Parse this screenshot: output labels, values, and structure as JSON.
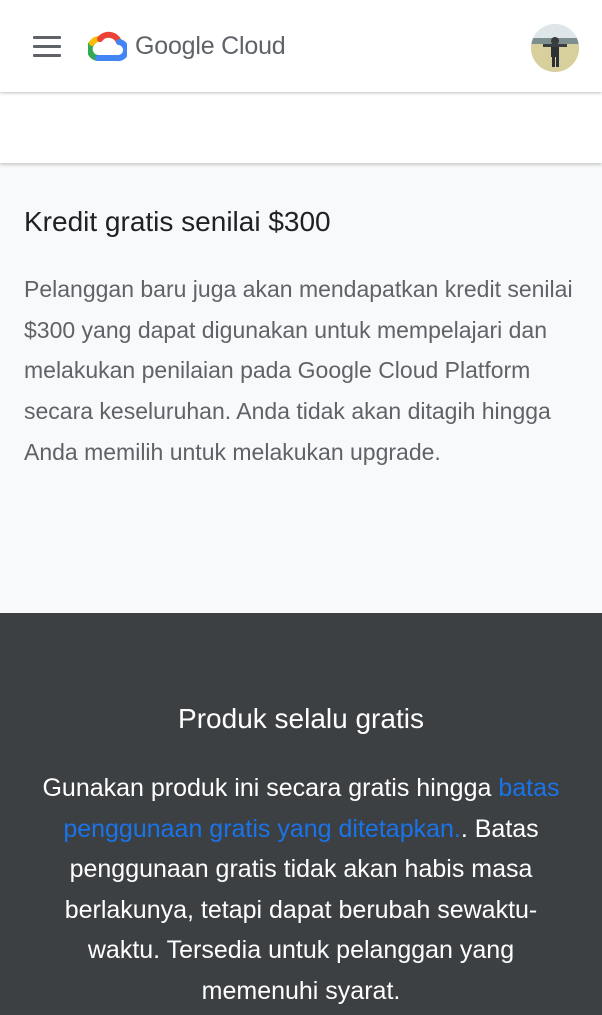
{
  "header": {
    "brand": "Google Cloud",
    "menu_icon": "hamburger-menu-icon",
    "logo_icon": "google-cloud-logo-icon",
    "avatar_icon": "user-avatar",
    "colors": {
      "blue": "#4285f4",
      "red": "#ea4335",
      "yellow": "#fbbc04",
      "green": "#34a853"
    }
  },
  "credit": {
    "title": "Kredit gratis senilai $300",
    "description": "Pelanggan baru juga akan mendapatkan kredit senilai $300 yang dapat digunakan untuk mempelajari dan melakukan penilaian pada Google Cloud Platform secara keseluruhan. Anda tidak akan ditagih hingga Anda memilih untuk melakukan upgrade."
  },
  "free_products": {
    "title": "Produk selalu gratis",
    "intro": "Gunakan produk ini secara gratis hingga ",
    "link_text": "batas penggunaan gratis yang ditetapkan.",
    "body": ". Batas penggunaan gratis tidak akan habis masa berlakunya, tetapi dapat berubah sewaktu-waktu. Tersedia untuk pelanggan yang memenuhi syarat.",
    "link_color": "#1a73e8"
  },
  "theme": {
    "page_background": "#f8f9fa",
    "dark_background": "#3c4043",
    "text_primary": "#202124",
    "text_secondary": "#5f6368"
  }
}
